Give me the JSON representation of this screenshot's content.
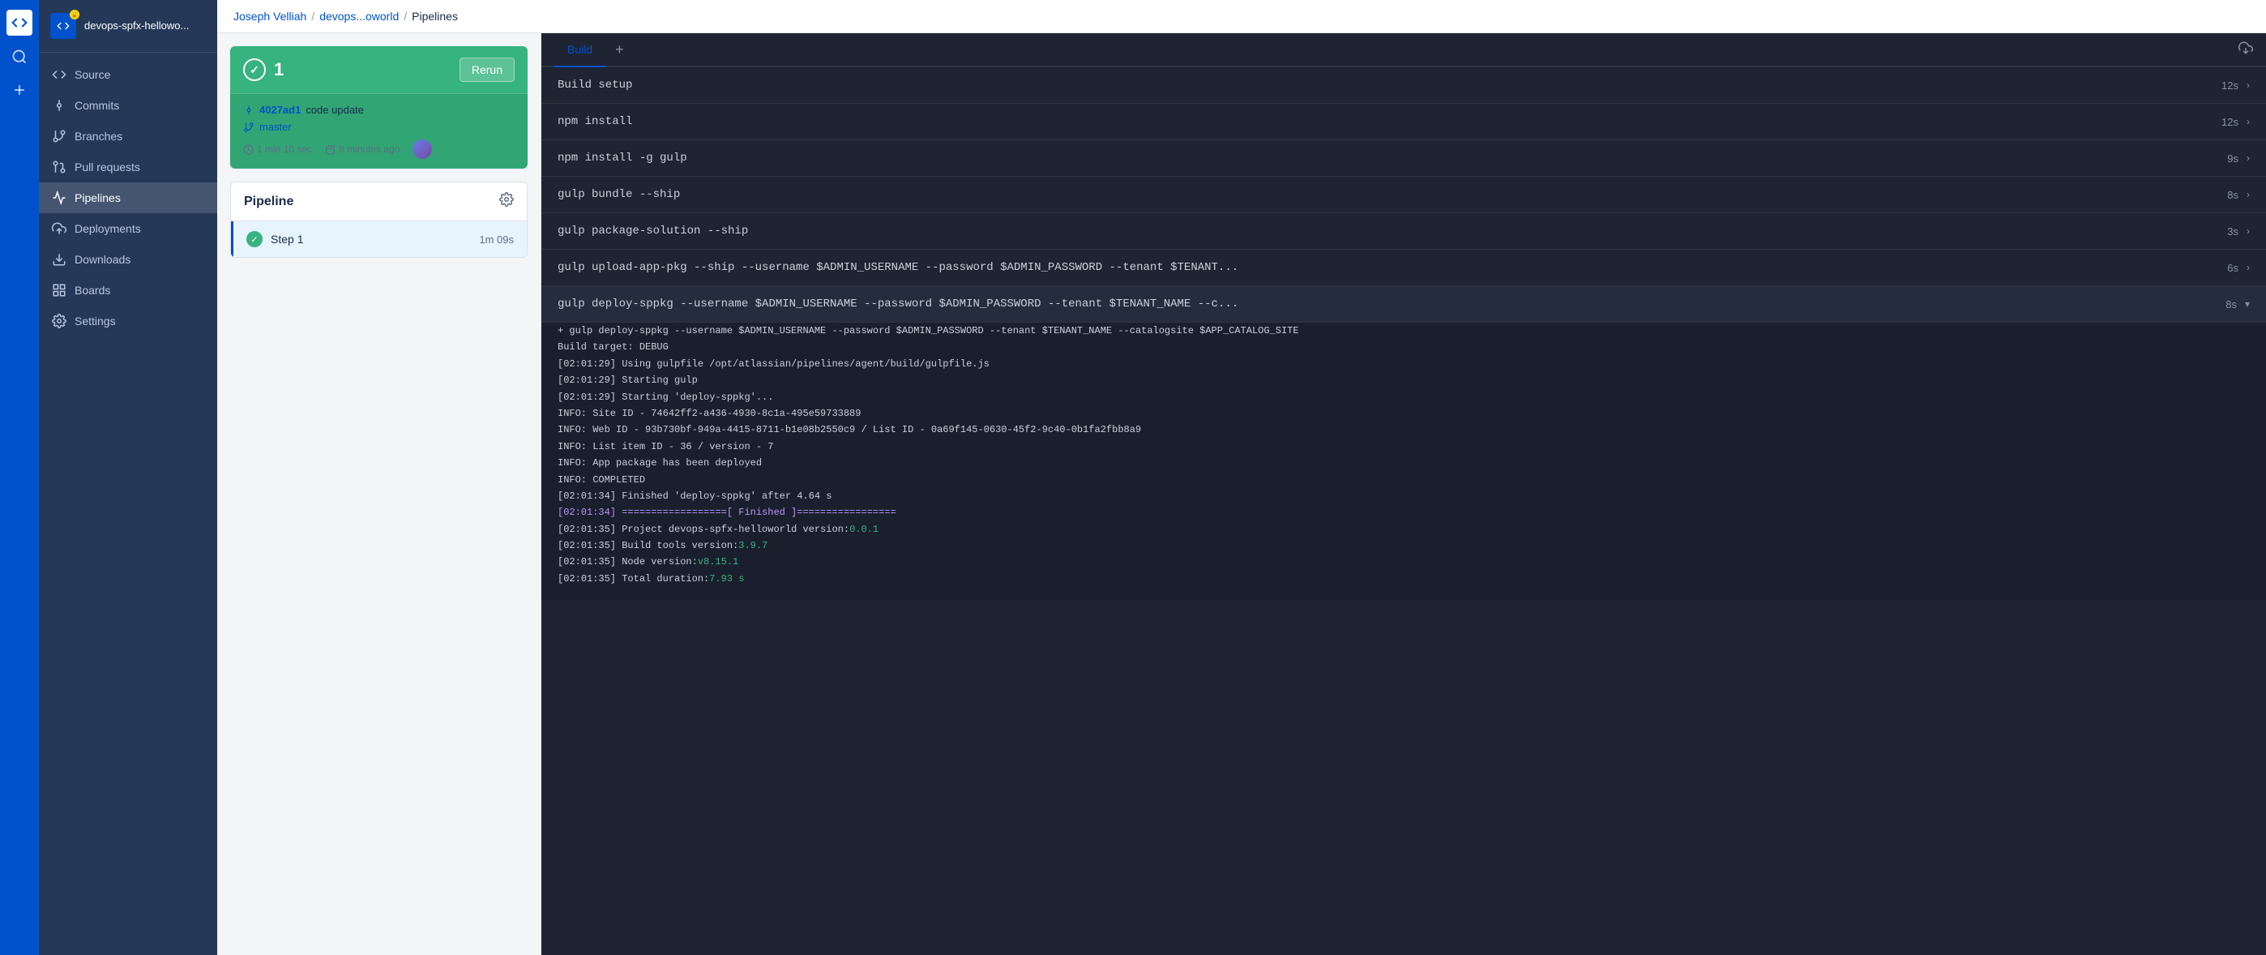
{
  "brand": {
    "logo_text": "</>",
    "search_icon": "🔍",
    "add_icon": "+"
  },
  "sidebar": {
    "repo_name": "devops-spfx-hellowo...",
    "nav_items": [
      {
        "id": "source",
        "label": "Source",
        "icon": "source"
      },
      {
        "id": "commits",
        "label": "Commits",
        "icon": "commits"
      },
      {
        "id": "branches",
        "label": "Branches",
        "icon": "branches"
      },
      {
        "id": "pull-requests",
        "label": "Pull requests",
        "icon": "pull-requests"
      },
      {
        "id": "pipelines",
        "label": "Pipelines",
        "icon": "pipelines",
        "active": true
      },
      {
        "id": "deployments",
        "label": "Deployments",
        "icon": "deployments"
      },
      {
        "id": "downloads",
        "label": "Downloads",
        "icon": "downloads"
      },
      {
        "id": "boards",
        "label": "Boards",
        "icon": "boards"
      },
      {
        "id": "settings",
        "label": "Settings",
        "icon": "settings"
      }
    ]
  },
  "breadcrumb": {
    "user": "Joseph Velliah",
    "repo": "devops...oworld",
    "current": "Pipelines"
  },
  "build_run": {
    "number": "1",
    "status": "success",
    "rerun_label": "Rerun",
    "commit_hash": "4027ad1",
    "commit_msg": "code update",
    "branch": "master",
    "duration": "1 min 10 sec",
    "time_ago": "8 minutes ago"
  },
  "pipeline": {
    "title": "Pipeline",
    "steps": [
      {
        "name": "Step 1",
        "time": "1m 09s",
        "status": "success"
      }
    ]
  },
  "build_log": {
    "active_tab": "Build",
    "tabs": [
      "Build"
    ],
    "log_items": [
      {
        "id": "build-setup",
        "name": "Build setup",
        "time": "12s",
        "expanded": false
      },
      {
        "id": "npm-install",
        "name": "npm install",
        "time": "12s",
        "expanded": false
      },
      {
        "id": "npm-install-gulp",
        "name": "npm install -g gulp",
        "time": "9s",
        "expanded": false
      },
      {
        "id": "gulp-bundle",
        "name": "gulp bundle --ship",
        "time": "8s",
        "expanded": false
      },
      {
        "id": "gulp-package",
        "name": "gulp package-solution --ship",
        "time": "3s",
        "expanded": false
      },
      {
        "id": "gulp-upload",
        "name": "gulp upload-app-pkg --ship --username $ADMIN_USERNAME --password $ADMIN_PASSWORD --tenant $TENANT...",
        "time": "6s",
        "expanded": false
      },
      {
        "id": "gulp-deploy",
        "name": "gulp deploy-sppkg --username $ADMIN_USERNAME --password $ADMIN_PASSWORD --tenant $TENANT_NAME --c...",
        "time": "8s",
        "expanded": true
      }
    ],
    "expanded_log": [
      "+ gulp deploy-sppkg --username $ADMIN_USERNAME --password $ADMIN_PASSWORD --tenant $TENANT_NAME --catalogsite $APP_CATALOG_SITE",
      "Build target: DEBUG",
      "[02:01:29] Using gulpfile /opt/atlassian/pipelines/agent/build/gulpfile.js",
      "[02:01:29] Starting gulp",
      "[02:01:29] Starting 'deploy-sppkg'...",
      "INFO: Site ID - 74642ff2-a436-4930-8c1a-495e59733889",
      "INFO: Web ID - 93b730bf-949a-4415-8711-b1e08b2550c9 / List ID - 0a69f145-0630-45f2-9c40-0b1fa2fbb8a9",
      "INFO: List item ID - 36 / version - 7",
      "INFO: App package has been deployed",
      "INFO: COMPLETED",
      "[02:01:34] Finished 'deploy-sppkg' after 4.64 s",
      "[02:01:34] ==================[ Finished ]=================",
      "[02:01:35] Project devops-spfx-helloworld version:0.0.1",
      "[02:01:35] Build tools version:3.9.7",
      "[02:01:35] Node version:v8.15.1",
      "[02:01:35] Total duration:7.93 s"
    ]
  }
}
